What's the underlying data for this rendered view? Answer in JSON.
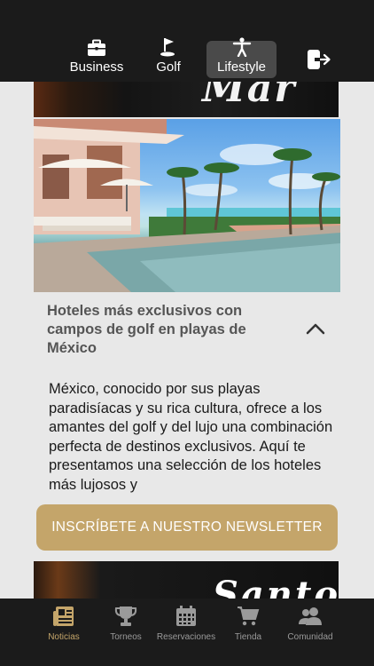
{
  "top_nav": {
    "tabs": [
      {
        "label": "Business",
        "icon": "briefcase-icon"
      },
      {
        "label": "Golf",
        "icon": "golf-flag-icon"
      },
      {
        "label": "Lifestyle",
        "icon": "person-icon",
        "active": true
      }
    ],
    "logout_icon": "logout-icon"
  },
  "banner_top": {
    "text": "Mar"
  },
  "article": {
    "title": "Hoteles más exclusivos con campos de golf en playas de México",
    "body": "México, conocido por sus playas paradisíacas y su rica cultura, ofrece a los amantes del golf y del lujo una combinación perfecta de destinos exclusivos. Aquí te presentamos una selección de los hoteles más lujosos y"
  },
  "newsletter_button": {
    "label": "INSCRÍBETE A NUESTRO NEWSLETTER"
  },
  "banner_bottom": {
    "text": "Santo"
  },
  "bottom_nav": {
    "items": [
      {
        "label": "Noticias",
        "icon": "newspaper-icon",
        "active": true
      },
      {
        "label": "Torneos",
        "icon": "trophy-icon"
      },
      {
        "label": "Reservaciones",
        "icon": "calendar-icon"
      },
      {
        "label": "Tienda",
        "icon": "cart-icon"
      },
      {
        "label": "Comunidad",
        "icon": "users-icon"
      }
    ]
  },
  "colors": {
    "bar_bg": "#1b1b1b",
    "accent_gold": "#c4a56a",
    "active_tab_bg": "#4a4a4a",
    "content_bg": "#e8e8e8"
  }
}
